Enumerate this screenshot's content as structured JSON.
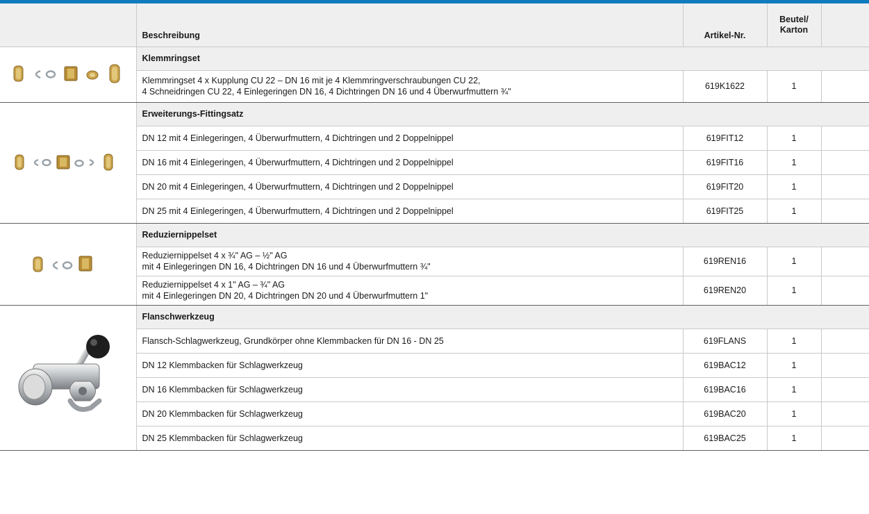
{
  "header": {
    "description": "Beschreibung",
    "article": "Artikel-Nr.",
    "qty_line1": "Beutel/",
    "qty_line2": "Karton"
  },
  "groups": [
    {
      "title": "Klemmringset",
      "image_icon": "fitting-parts-icon",
      "rows": [
        {
          "line1": "Klemmringset 4 x Kupplung CU 22 – DN 16 mit je 4 Klemmringverschraubungen CU 22,",
          "line2": "4 Schneidringen CU 22, 4 Einlegeringen DN 16, 4 Dichtringen DN 16 und 4 Überwurfmuttern ¾\"",
          "article": "619K1622",
          "qty": "1"
        }
      ]
    },
    {
      "title": "Erweiterungs-Fittingsatz",
      "image_icon": "fitting-parts-icon",
      "rows": [
        {
          "line1": "DN 12 mit 4 Einlegeringen, 4 Überwurfmuttern, 4 Dichtringen und 2 Doppelnippel",
          "article": "619FIT12",
          "qty": "1"
        },
        {
          "line1": "DN 16 mit 4 Einlegeringen, 4 Überwurfmuttern, 4 Dichtringen und 2 Doppelnippel",
          "article": "619FIT16",
          "qty": "1"
        },
        {
          "line1": "DN 20 mit 4 Einlegeringen, 4 Überwurfmuttern, 4 Dichtringen und 2 Doppelnippel",
          "article": "619FIT20",
          "qty": "1"
        },
        {
          "line1": "DN 25 mit 4 Einlegeringen, 4 Überwurfmuttern, 4 Dichtringen und 2 Doppelnippel",
          "article": "619FIT25",
          "qty": "1"
        }
      ]
    },
    {
      "title": "Reduziernippelset",
      "image_icon": "fitting-parts-icon",
      "rows": [
        {
          "line1": "Reduziernippelset 4 x ¾\" AG – ½\" AG",
          "line2": "mit 4 Einlegeringen DN 16, 4 Dichtringen DN 16 und 4 Überwurfmuttern ¾\"",
          "article": "619REN16",
          "qty": "1"
        },
        {
          "line1": "Reduziernippelset 4 x 1\" AG – ¾\" AG",
          "line2": "mit 4 Einlegeringen DN 20, 4 Dichtringen DN 20 und 4 Überwurfmuttern 1\"",
          "article": "619REN20",
          "qty": "1"
        }
      ]
    },
    {
      "title": "Flanschwerkzeug",
      "image_icon": "flange-tool-icon",
      "rows": [
        {
          "line1": "Flansch-Schlagwerkzeug, Grundkörper ohne Klemmbacken für DN 16 - DN 25",
          "article": "619FLANS",
          "qty": "1"
        },
        {
          "line1": "DN 12 Klemmbacken für Schlagwerkzeug",
          "article": "619BAC12",
          "qty": "1"
        },
        {
          "line1": "DN 16 Klemmbacken für Schlagwerkzeug",
          "article": "619BAC16",
          "qty": "1"
        },
        {
          "line1": "DN 20 Klemmbacken für Schlagwerkzeug",
          "article": "619BAC20",
          "qty": "1"
        },
        {
          "line1": "DN 25 Klemmbacken für Schlagwerkzeug",
          "article": "619BAC25",
          "qty": "1"
        }
      ]
    }
  ],
  "colors": {
    "accent": "#0e7bbf",
    "header_bg": "#efefef",
    "brass": "#c9a24a"
  }
}
